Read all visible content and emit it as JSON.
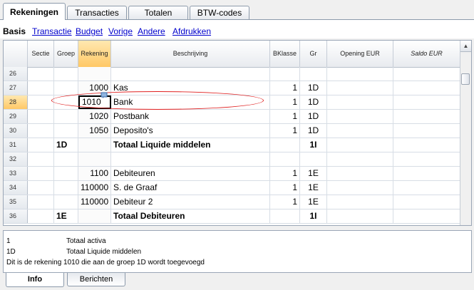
{
  "top_tabs": [
    "Rekeningen",
    "Transacties",
    "Totalen",
    "BTW-codes"
  ],
  "subtabs": {
    "active": "Basis",
    "links": [
      "Transactie",
      "Budget",
      "Vorige",
      "Andere",
      "Afdrukken"
    ]
  },
  "columns": [
    "Sectie",
    "Groep",
    "Rekening",
    "Beschrijving",
    "BKlasse",
    "Gr",
    "Opening EUR",
    "Saldo EUR"
  ],
  "rows": [
    {
      "num": "26",
      "sectie": "",
      "groep": "",
      "rekening": "",
      "beschrijving": "",
      "bklasse": "",
      "gr": ""
    },
    {
      "num": "27",
      "sectie": "",
      "groep": "",
      "rekening": "1000",
      "beschrijving": "Kas",
      "bklasse": "1",
      "gr": "1D"
    },
    {
      "num": "28",
      "sectie": "",
      "groep": "",
      "rekening": "1010",
      "beschrijving": "Bank",
      "bklasse": "1",
      "gr": "1D"
    },
    {
      "num": "29",
      "sectie": "",
      "groep": "",
      "rekening": "1020",
      "beschrijving": "Postbank",
      "bklasse": "1",
      "gr": "1D"
    },
    {
      "num": "30",
      "sectie": "",
      "groep": "",
      "rekening": "1050",
      "beschrijving": "Deposito's",
      "bklasse": "1",
      "gr": "1D"
    },
    {
      "num": "31",
      "sectie": "",
      "groep": "1D",
      "rekening": "",
      "beschrijving": "Totaal Liquide middelen",
      "bklasse": "",
      "gr": "1I"
    },
    {
      "num": "32",
      "sectie": "",
      "groep": "",
      "rekening": "",
      "beschrijving": "",
      "bklasse": "",
      "gr": ""
    },
    {
      "num": "33",
      "sectie": "",
      "groep": "",
      "rekening": "1100",
      "beschrijving": "Debiteuren",
      "bklasse": "1",
      "gr": "1E"
    },
    {
      "num": "34",
      "sectie": "",
      "groep": "",
      "rekening": "110000",
      "beschrijving": "S. de Graaf",
      "bklasse": "1",
      "gr": "1E"
    },
    {
      "num": "35",
      "sectie": "",
      "groep": "",
      "rekening": "110000",
      "beschrijving": "Debiteur 2",
      "bklasse": "1",
      "gr": "1E"
    },
    {
      "num": "36",
      "sectie": "",
      "groep": "1E",
      "rekening": "",
      "beschrijving": "Totaal Debiteuren",
      "bklasse": "",
      "gr": "1I"
    }
  ],
  "info_lines": [
    {
      "code": "1",
      "text": "Totaal activa"
    },
    {
      "code": "1D",
      "text": "Totaal Liquide middelen"
    },
    {
      "code": "",
      "text": "Dit is de rekening 1010 die aan de groep 1D wordt toegevoegd"
    }
  ],
  "bottom_tabs": [
    "Info",
    "Berichten"
  ]
}
